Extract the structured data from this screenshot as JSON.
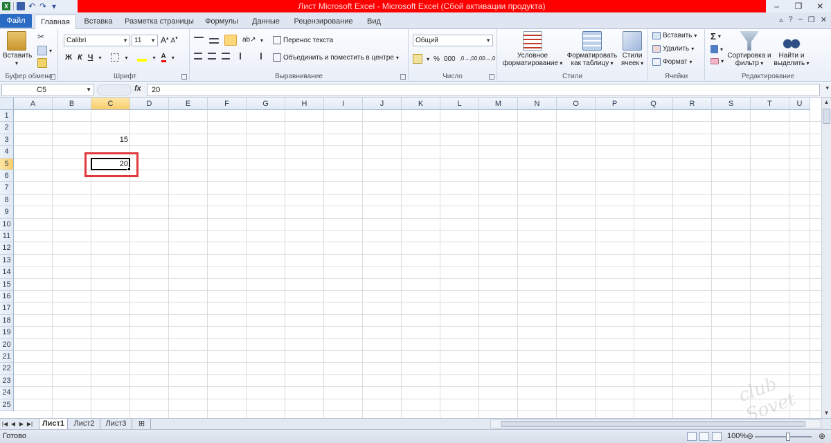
{
  "window": {
    "title": "Лист Microsoft Excel  -  Microsoft Excel (Сбой активации продукта)",
    "minimize": "–",
    "maximize": "❐",
    "close": "✕"
  },
  "ribbon_tabs": [
    {
      "label": "Файл"
    },
    {
      "label": "Главная"
    },
    {
      "label": "Вставка"
    },
    {
      "label": "Разметка страницы"
    },
    {
      "label": "Формулы"
    },
    {
      "label": "Данные"
    },
    {
      "label": "Рецензирование"
    },
    {
      "label": "Вид"
    }
  ],
  "groups": {
    "clipboard": {
      "label": "Буфер обмена",
      "paste": "Вставить"
    },
    "font": {
      "label": "Шрифт",
      "font_name": "Calibri",
      "font_size": "11",
      "bold": "Ж",
      "italic": "К",
      "underline": "Ч"
    },
    "alignment": {
      "label": "Выравнивание",
      "wrap": "Перенос текста",
      "merge": "Объединить и поместить в центре"
    },
    "number": {
      "label": "Число",
      "format": "Общий",
      "percent": "%",
      "thousands": "000",
      "inc_decimal": ",0→,00",
      "dec_decimal": ",00→,0"
    },
    "styles": {
      "label": "Стили",
      "conditional": "Условное форматирование",
      "format_table": "Форматировать как таблицу",
      "cell_styles": "Стили ячеек"
    },
    "cells": {
      "label": "Ячейки",
      "insert": "Вставить",
      "delete": "Удалить",
      "format": "Формат"
    },
    "editing": {
      "label": "Редактирование",
      "sort": "Сортировка и фильтр",
      "find": "Найти и выделить"
    }
  },
  "formula_bar": {
    "name_box": "C5",
    "fx": "fx",
    "value": "20"
  },
  "columns": [
    "A",
    "B",
    "C",
    "D",
    "E",
    "F",
    "G",
    "H",
    "I",
    "J",
    "K",
    "L",
    "M",
    "N",
    "O",
    "P",
    "Q",
    "R",
    "S",
    "T",
    "U"
  ],
  "rows": [
    "1",
    "2",
    "3",
    "4",
    "5",
    "6",
    "7",
    "8",
    "9",
    "10",
    "11",
    "12",
    "13",
    "14",
    "15",
    "16",
    "17",
    "18",
    "19",
    "20",
    "21",
    "22",
    "23",
    "24",
    "25"
  ],
  "selected_column": "C",
  "selected_row": "5",
  "cells": {
    "C3": "15",
    "C5": "20"
  },
  "sheets": [
    {
      "label": "Лист1",
      "active": true
    },
    {
      "label": "Лист2",
      "active": false
    },
    {
      "label": "Лист3",
      "active": false
    }
  ],
  "status": {
    "ready": "Готово",
    "zoom": "100%"
  },
  "colors": {
    "title_bar": "#ff0000",
    "highlight_border": "#e03a3e",
    "selected_header": "#f8cd6c",
    "file_tab": "#2a6cc4"
  }
}
